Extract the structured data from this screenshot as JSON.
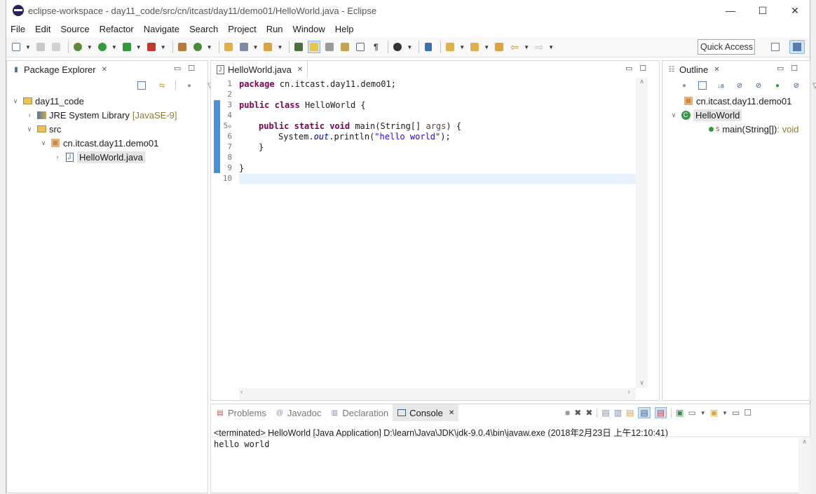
{
  "window": {
    "title": "eclipse-workspace - day11_code/src/cn/itcast/day11/demo01/HelloWorld.java - Eclipse",
    "min": "—",
    "max": "☐",
    "close": "✕"
  },
  "menu": [
    "File",
    "Edit",
    "Source",
    "Refactor",
    "Navigate",
    "Search",
    "Project",
    "Run",
    "Window",
    "Help"
  ],
  "toolbar": {
    "quick_access": "Quick Access"
  },
  "package_explorer": {
    "tab_label": "Package Explorer",
    "tree": {
      "project": "day11_code",
      "jre": "JRE System Library",
      "jre_suffix": "[JavaSE-9]",
      "src": "src",
      "package": "cn.itcast.day11.demo01",
      "file": "HelloWorld.java"
    }
  },
  "editor": {
    "tab_label": "HelloWorld.java",
    "line_numbers": [
      "1",
      "2",
      "3",
      "4",
      "5",
      "6",
      "7",
      "8",
      "9",
      "10"
    ],
    "fold_marker": "⊖",
    "code": {
      "l1_kw": "package",
      "l1_rest": " cn.itcast.day11.demo01;",
      "l3_kw1": "public",
      "l3_kw2": "class",
      "l3_rest": " HelloWorld {",
      "l5_kw1": "public",
      "l5_kw2": "static",
      "l5_kw3": "void",
      "l5_rest1": " main(String[] ",
      "l5_param": "args",
      "l5_rest2": ") {",
      "l6_a": "System.",
      "l6_field": "out",
      "l6_b": ".println(",
      "l6_str": "\"hello world\"",
      "l6_c": ");",
      "l7": "}",
      "l9": "}"
    }
  },
  "outline": {
    "tab_label": "Outline",
    "package": "cn.itcast.day11.demo01",
    "class": "HelloWorld",
    "method_super": "S",
    "method": "main(String[])",
    "method_type": " : void"
  },
  "bottom": {
    "tabs": [
      {
        "label": "Problems",
        "icon": "problems-icon"
      },
      {
        "label": "Javadoc",
        "icon": "at-icon"
      },
      {
        "label": "Declaration",
        "icon": "declaration-icon"
      },
      {
        "label": "Console",
        "icon": "console-icon"
      }
    ],
    "console_header": "<terminated> HelloWorld [Java Application] D:\\learn\\Java\\JDK\\jdk-9.0.4\\bin\\javaw.exe (2018年2月23日 上午12:10:41)",
    "console_output": "hello world"
  },
  "colors": {
    "accent": "#4a90d9",
    "keyword": "#7f0055",
    "string": "#2a00ff"
  }
}
